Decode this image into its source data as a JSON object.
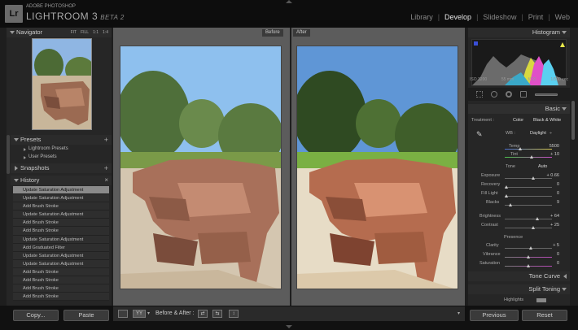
{
  "app": {
    "brand_small": "ADOBE PHOTOSHOP",
    "brand_name": "LIGHTROOM 3",
    "brand_beta": "BETA 2",
    "logo": "Lr"
  },
  "modules": [
    "Library",
    "Develop",
    "Slideshow",
    "Print",
    "Web"
  ],
  "active_module": "Develop",
  "left": {
    "navigator": {
      "title": "Navigator",
      "opts": [
        "FIT",
        "FILL",
        "1:1",
        "1:4"
      ]
    },
    "presets": {
      "title": "Presets",
      "items": [
        "Lightroom Presets",
        "User Presets"
      ]
    },
    "snapshots": {
      "title": "Snapshots"
    },
    "history": {
      "title": "History",
      "items": [
        "Update Saturation Adjustment",
        "Update Saturation Adjustment",
        "Add Brush Stroke",
        "Update Saturation Adjustment",
        "Add Brush Stroke",
        "Add Brush Stroke",
        "Update Saturation Adjustment",
        "Add Graduated Filter",
        "Update Saturation Adjustment",
        "Update Saturation Adjustment",
        "Add Brush Stroke",
        "Add Brush Stroke",
        "Add Brush Stroke",
        "Add Brush Stroke"
      ]
    },
    "copy_label": "Copy...",
    "paste_label": "Paste"
  },
  "main": {
    "before_label": "Before",
    "after_label": "After",
    "toolbar_label": "Before & After :",
    "view_mode": "YY"
  },
  "right": {
    "histogram": {
      "title": "Histogram",
      "iso": "ISO 3200",
      "focal": "55 mm",
      "aperture": "f/ 22",
      "shutter": "1/500 sec"
    },
    "basic": {
      "title": "Basic",
      "treatment_label": "Treatment :",
      "color": "Color",
      "bw": "Black & White",
      "wb_label": "WB :",
      "wb_value": "Daylight",
      "temp_label": "Temp",
      "temp_value": "5500",
      "tint_label": "Tint",
      "tint_value": "+ 10",
      "tone_label": "Tone",
      "auto": "Auto",
      "exposure_label": "Exposure",
      "exposure_value": "+ 0.66",
      "recovery_label": "Recovery",
      "recovery_value": "0",
      "filllight_label": "Fill Light",
      "filllight_value": "0",
      "blacks_label": "Blacks",
      "blacks_value": "9",
      "brightness_label": "Brightness",
      "brightness_value": "+ 64",
      "contrast_label": "Contrast",
      "contrast_value": "+ 25",
      "presence_label": "Presence",
      "clarity_label": "Clarity",
      "clarity_value": "+ 5",
      "vibrance_label": "Vibrance",
      "vibrance_value": "0",
      "saturation_label": "Saturation",
      "saturation_value": "0"
    },
    "tone_curve": "Tone Curve",
    "split_toning": "Split Toning",
    "highlights_label": "Highlights",
    "previous_label": "Previous",
    "reset_label": "Reset"
  }
}
